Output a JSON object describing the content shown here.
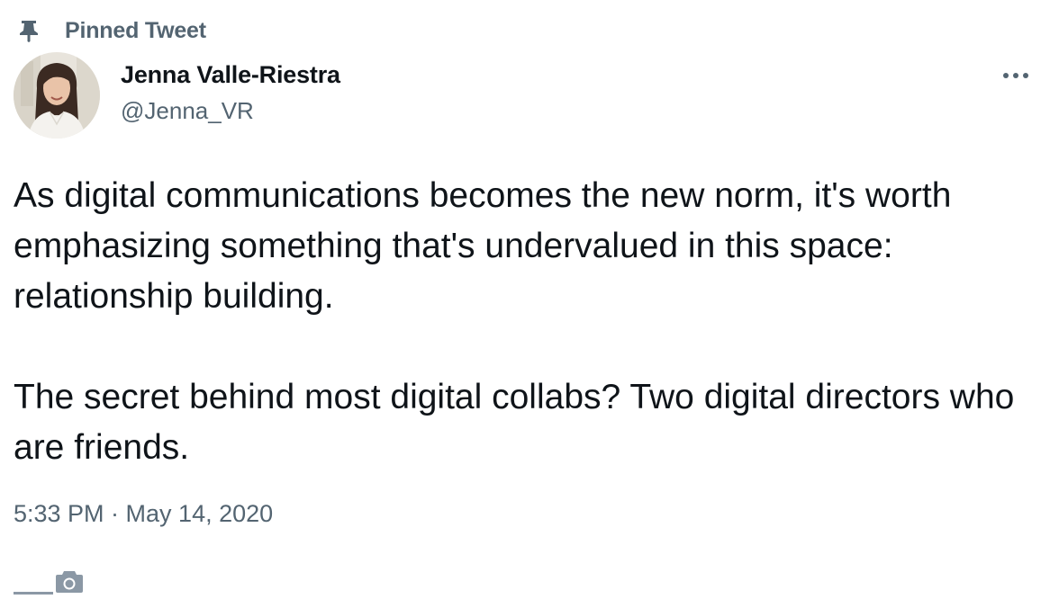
{
  "pinned": {
    "label": "Pinned Tweet",
    "icon": "pin-icon"
  },
  "author": {
    "name": "Jenna Valle-Riestra",
    "handle": "@Jenna_VR",
    "avatar_icon": "avatar"
  },
  "menu": {
    "icon": "more-icon"
  },
  "tweet": {
    "paragraph_1": "As digital communications becomes the new norm, it's worth emphasizing something that's undervalued in this space: relationship building.",
    "paragraph_2": "The secret behind most digital collabs? Two digital directors who are friends.",
    "timestamp": "5:33 PM · May 14, 2020"
  },
  "footer": {
    "icon": "camera-icon"
  },
  "colors": {
    "text_primary": "#0f1419",
    "text_secondary": "#536471",
    "background": "#ffffff"
  }
}
